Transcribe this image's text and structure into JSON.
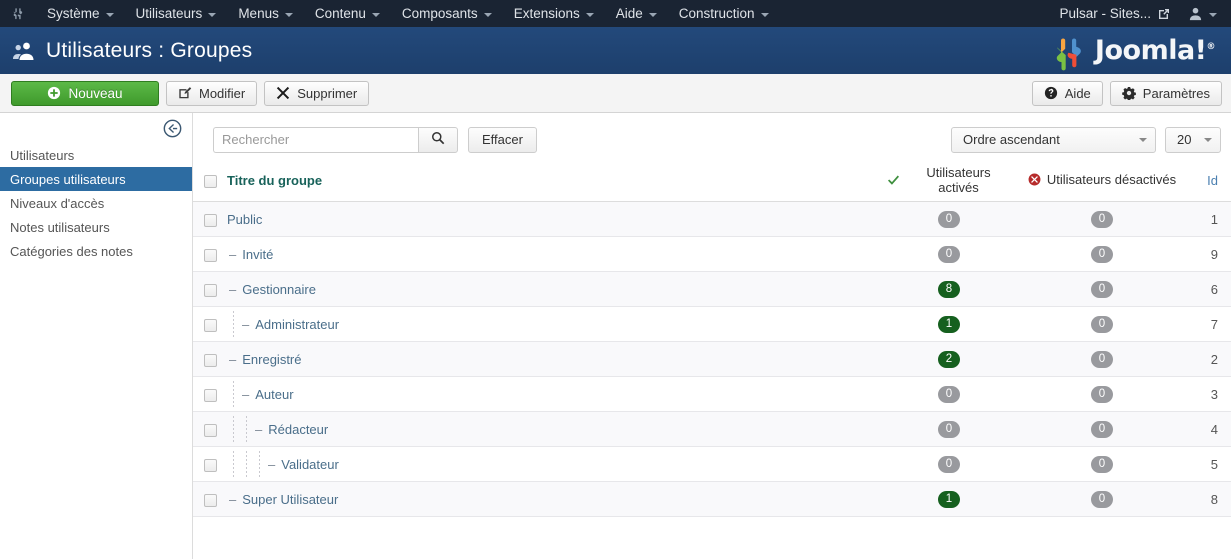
{
  "topnav": {
    "brand_icon": "joomla-mark-icon",
    "menus": [
      {
        "label": "Système"
      },
      {
        "label": "Utilisateurs"
      },
      {
        "label": "Menus"
      },
      {
        "label": "Contenu"
      },
      {
        "label": "Composants"
      },
      {
        "label": "Extensions"
      },
      {
        "label": "Aide"
      },
      {
        "label": "Construction"
      }
    ],
    "site_label": "Pulsar - Sites...",
    "site_icon": "external-link-icon",
    "user_icon": "user-icon"
  },
  "subhead": {
    "title": "Utilisateurs : Groupes",
    "page_icon": "users-icon",
    "logo_text": "Joomla!",
    "logo_reg": "®"
  },
  "toolbar": {
    "new_label": "Nouveau",
    "new_icon": "plus-circle-icon",
    "edit_label": "Modifier",
    "edit_icon": "pencil-square-icon",
    "delete_label": "Supprimer",
    "delete_icon": "x-mark-icon",
    "help_label": "Aide",
    "help_icon": "question-circle-icon",
    "options_label": "Paramètres",
    "options_icon": "gear-icon"
  },
  "sidebar": {
    "collapse_icon": "arrow-circle-left-icon",
    "items": [
      {
        "label": "Utilisateurs",
        "active": false
      },
      {
        "label": "Groupes utilisateurs",
        "active": true
      },
      {
        "label": "Niveaux d'accès",
        "active": false
      },
      {
        "label": "Notes utilisateurs",
        "active": false
      },
      {
        "label": "Catégories des notes",
        "active": false
      }
    ]
  },
  "filters": {
    "search_placeholder": "Rechercher",
    "search_value": "",
    "search_icon": "search-icon",
    "clear_label": "Effacer",
    "order_value": "Ordre ascendant",
    "limit_value": "20"
  },
  "table": {
    "headers": {
      "title": "Titre du groupe",
      "enabled": "Utilisateurs activés",
      "enabled_icon": "check-icon",
      "disabled": "Utilisateurs désactivés",
      "disabled_icon": "x-circle-icon",
      "id": "Id"
    },
    "rows": [
      {
        "title": "Public",
        "level": 0,
        "enabled": "0",
        "disabled": "0",
        "id": "1"
      },
      {
        "title": "Invité",
        "level": 1,
        "enabled": "0",
        "disabled": "0",
        "id": "9"
      },
      {
        "title": "Gestionnaire",
        "level": 1,
        "enabled": "8",
        "disabled": "0",
        "id": "6"
      },
      {
        "title": "Administrateur",
        "level": 2,
        "enabled": "1",
        "disabled": "0",
        "id": "7"
      },
      {
        "title": "Enregistré",
        "level": 1,
        "enabled": "2",
        "disabled": "0",
        "id": "2"
      },
      {
        "title": "Auteur",
        "level": 2,
        "enabled": "0",
        "disabled": "0",
        "id": "3"
      },
      {
        "title": "Rédacteur",
        "level": 3,
        "enabled": "0",
        "disabled": "0",
        "id": "4"
      },
      {
        "title": "Validateur",
        "level": 4,
        "enabled": "0",
        "disabled": "0",
        "id": "5"
      },
      {
        "title": "Super Utilisateur",
        "level": 1,
        "enabled": "1",
        "disabled": "0",
        "id": "8"
      }
    ]
  },
  "colors": {
    "nav_bg": "#1a2433",
    "subhead_bg": "#1f4372",
    "accent_green": "#3f9a2c",
    "badge_green": "#16601f",
    "badge_grey": "#999a9e",
    "active_sidebar": "#2d6ca2",
    "link_teal": "#18625a",
    "link_blue": "#4a6e8a"
  }
}
